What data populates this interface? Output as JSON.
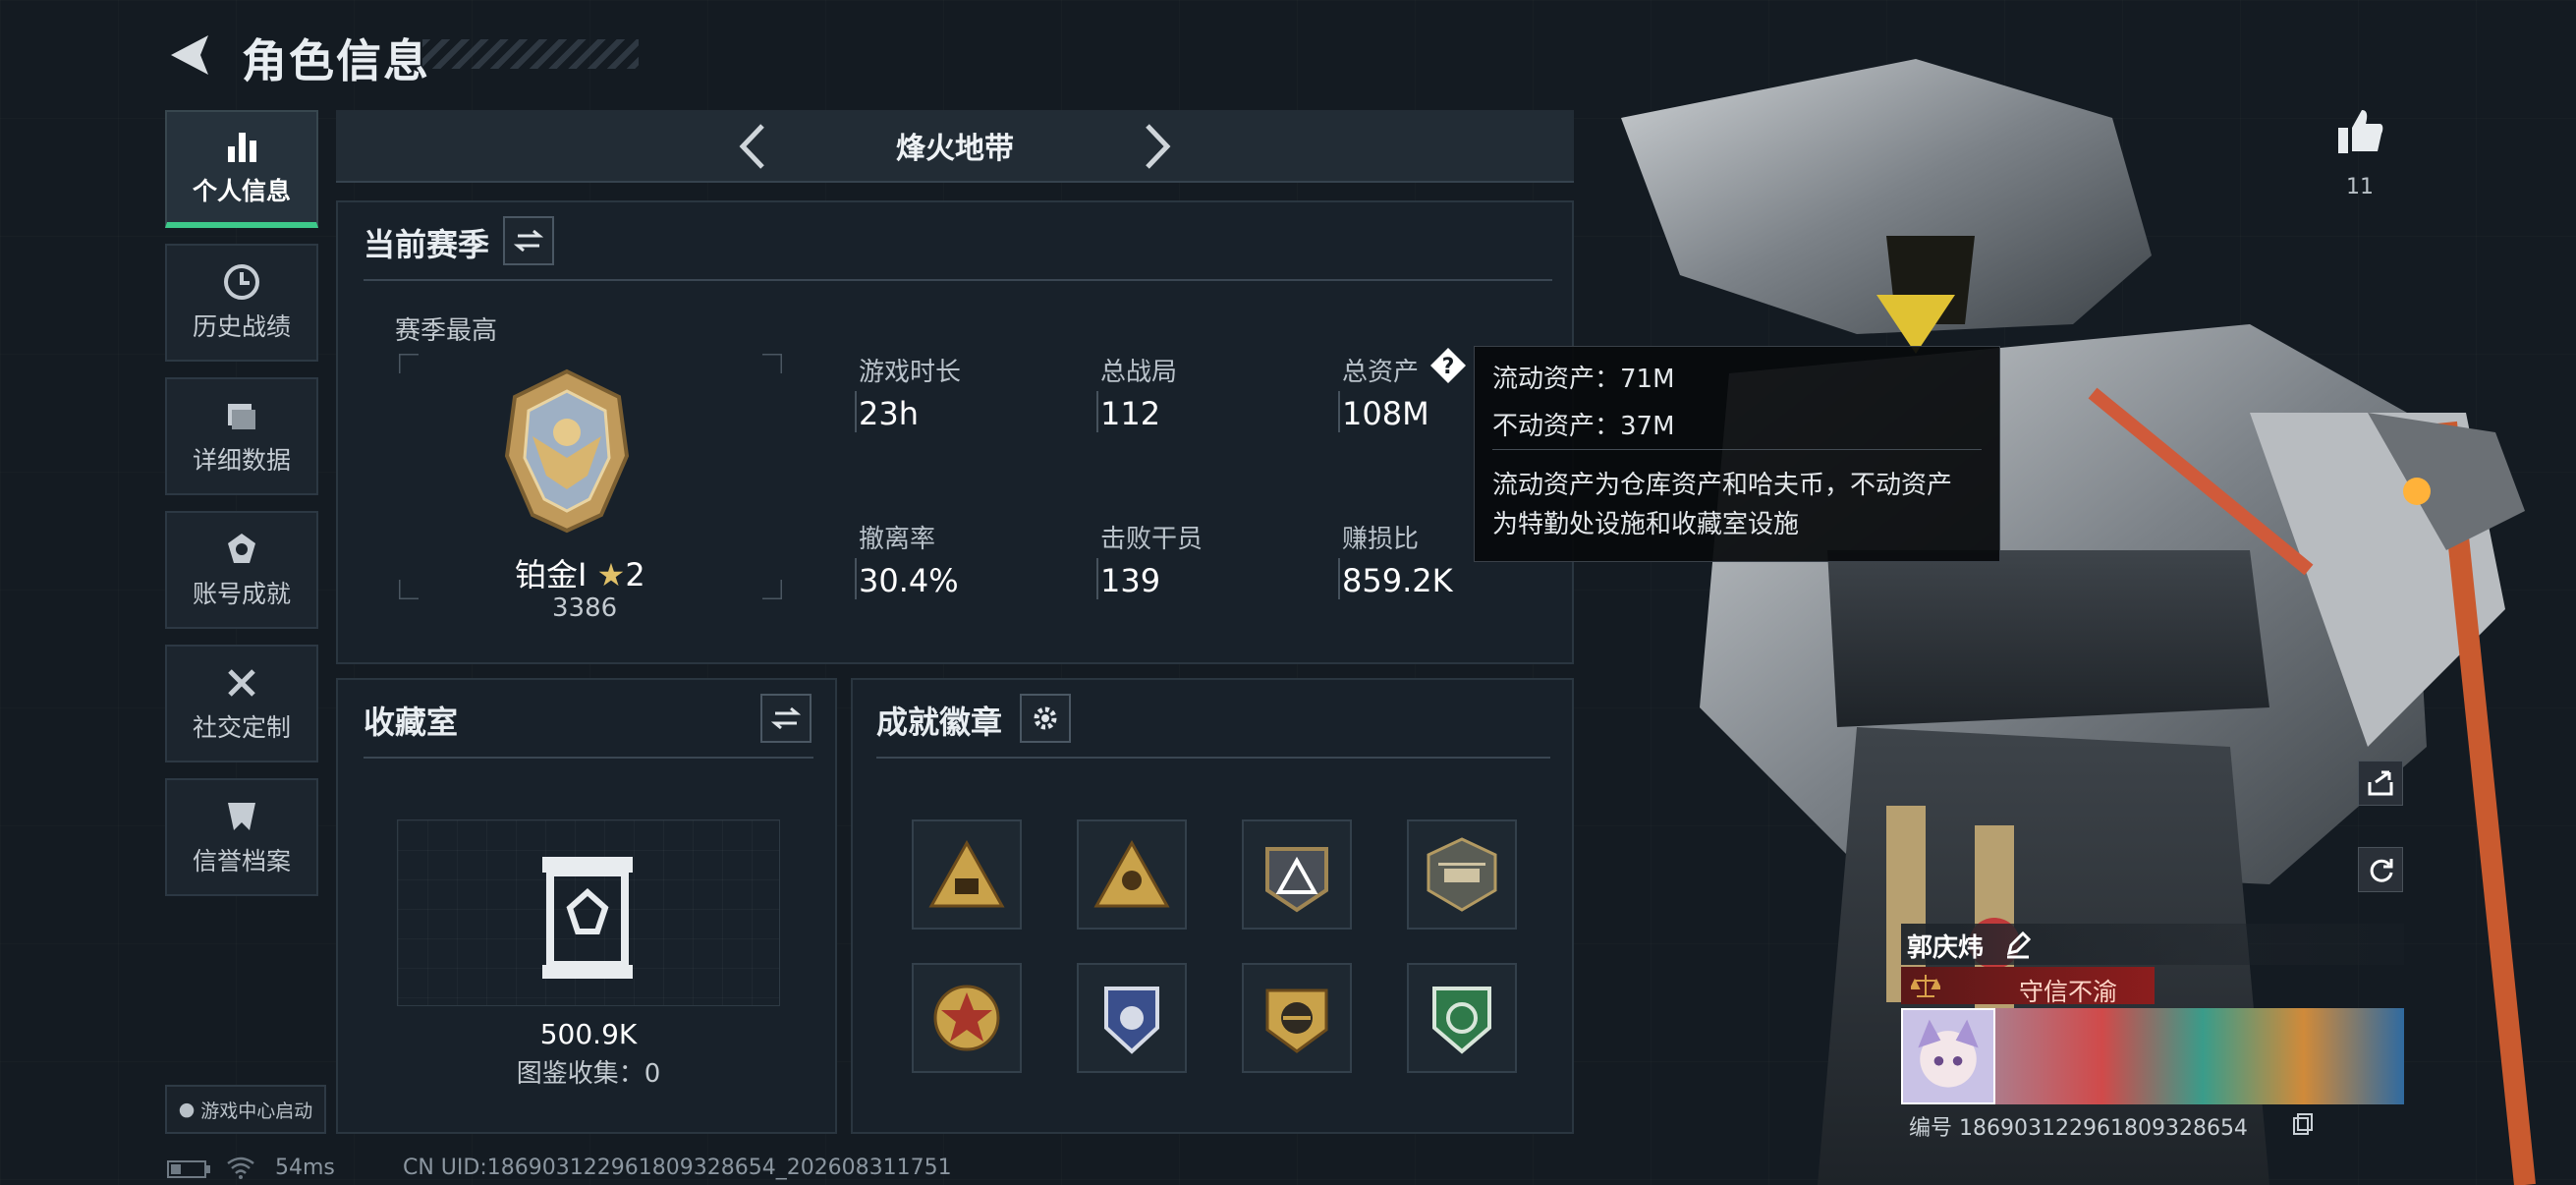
{
  "header": {
    "title": "角色信息"
  },
  "nav": {
    "items": [
      {
        "label": "个人信息",
        "icon": "bar-chart-icon",
        "active": true
      },
      {
        "label": "历史战绩",
        "icon": "clock-icon",
        "active": false
      },
      {
        "label": "详细数据",
        "icon": "folder-icon",
        "active": false
      },
      {
        "label": "账号成就",
        "icon": "medal-icon",
        "active": false
      },
      {
        "label": "社交定制",
        "icon": "tools-icon",
        "active": false
      },
      {
        "label": "信誉档案",
        "icon": "shield-icon",
        "active": false
      }
    ],
    "game_center_label": "游戏中心启动"
  },
  "mode": {
    "title": "烽火地带"
  },
  "season": {
    "title": "当前赛季",
    "best_label": "赛季最高",
    "rank_name": "铂金I",
    "rank_stars": "2",
    "rank_points": "3386",
    "stats": [
      {
        "label": "游戏时长",
        "value": "23h"
      },
      {
        "label": "总战局",
        "value": "112"
      },
      {
        "label": "总资产",
        "value": "108M"
      },
      {
        "label": "撤离率",
        "value": "30.4%"
      },
      {
        "label": "击败干员",
        "value": "139"
      },
      {
        "label": "赚损比",
        "value": "859.2K"
      }
    ]
  },
  "tooltip": {
    "liquid": "流动资产：71M",
    "fixed": "不动资产：37M",
    "note_line1": "流动资产为仓库资产和哈夫币，不动资产",
    "note_line2": "为特勤处设施和收藏室设施"
  },
  "collection": {
    "title": "收藏室",
    "value": "500.9K",
    "catalog": "图鉴收集：0"
  },
  "badges": {
    "title": "成就徽章",
    "items": [
      "triangle-badge-icon",
      "soldiers-badge-icon",
      "mountain-badge-icon",
      "helicopter-badge-icon",
      "star-badge-icon",
      "police-badge-icon",
      "eagle-badge-icon",
      "leaf-badge-icon"
    ]
  },
  "likes": {
    "count": "11"
  },
  "player": {
    "name": "郭庆炜",
    "title": "守信不渝",
    "uid_label": "编号 186903122961809328654"
  },
  "status": {
    "ping": "54ms",
    "uid_line": "CN UID:186903122961809328654_202608311751"
  },
  "colors": {
    "accent": "#3dc98a",
    "reputation": "#8c1d1d",
    "gold": "#c9a24a"
  }
}
